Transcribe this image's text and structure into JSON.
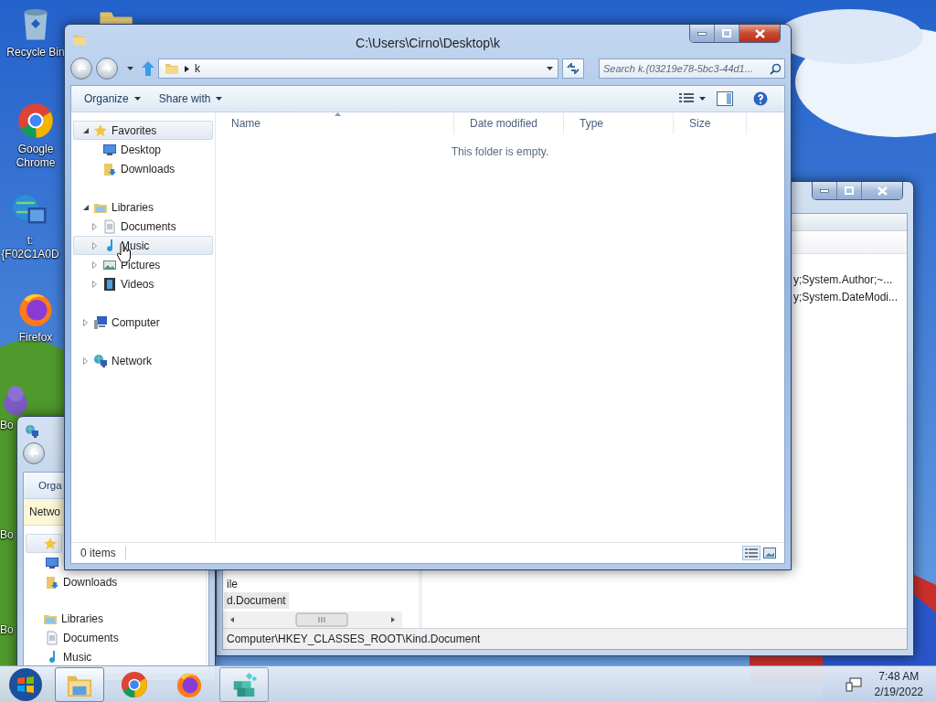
{
  "desktop_icons": [
    {
      "kind": "recycle",
      "label": "Recycle Bin"
    },
    {
      "kind": "folder"
    },
    {
      "kind": "chrome",
      "label": "Google Chrome"
    },
    {
      "kind": "globe_monitor",
      "label": "t:{F02C1A0D"
    },
    {
      "kind": "firefox",
      "label": "Firefox"
    },
    {
      "kind": "figure",
      "label": "Bo"
    },
    {
      "label": "Bo"
    },
    {
      "label": "Bo"
    }
  ],
  "registry_window": {
    "tree_items": [
      {
        "label": "ile",
        "selected": false
      },
      {
        "label": "d.Document",
        "selected": true
      }
    ],
    "values": [
      "y;System.Author;~...",
      "y;System.DateModi..."
    ],
    "status_bar": "Computer\\HKEY_CLASSES_ROOT\\Kind.Document"
  },
  "back_window": {
    "toolbar": "Orga",
    "info_bar": "Netwo",
    "nav": [
      {
        "kind": "favorites",
        "highlighted": true,
        "children": [
          {
            "kind": "desktop",
            "highlighted": false
          },
          {
            "kind": "downloads",
            "label": "Downloads",
            "highlighted": false
          }
        ]
      },
      {
        "kind": "libraries",
        "label": "Libraries",
        "highlighted": false,
        "children": [
          {
            "kind": "documents",
            "label": "Documents",
            "highlighted": false
          },
          {
            "kind": "music",
            "label": "Music",
            "highlighted": false
          }
        ]
      }
    ]
  },
  "window": {
    "title": "C:\\Users\\Cirno\\Desktop\\k",
    "breadcrumb": [
      "k"
    ],
    "search": {
      "placeholder": "Search k.{03219e78-5bc3-44d1..."
    },
    "toolbar": [
      "Organize",
      "Share with"
    ],
    "nav": [
      {
        "kind": "favorites",
        "label": "Favorites",
        "expanded": true,
        "highlighted": true,
        "children": [
          {
            "kind": "desktop",
            "label": "Desktop",
            "highlighted": false
          },
          {
            "kind": "downloads",
            "label": "Downloads",
            "highlighted": false
          }
        ]
      },
      {
        "kind": "libraries",
        "label": "Libraries",
        "expanded": true,
        "highlighted": false,
        "children": [
          {
            "kind": "documents",
            "label": "Documents",
            "expanded": false,
            "highlighted": false
          },
          {
            "kind": "music",
            "label": "Music",
            "expanded": false,
            "highlighted": true
          },
          {
            "kind": "pictures",
            "label": "Pictures",
            "expanded": false,
            "highlighted": false
          },
          {
            "kind": "videos",
            "label": "Videos",
            "expanded": false,
            "highlighted": false
          }
        ]
      },
      {
        "kind": "computer",
        "label": "Computer",
        "expanded": false,
        "highlighted": false
      },
      {
        "kind": "network",
        "label": "Network",
        "expanded": false,
        "highlighted": false
      }
    ],
    "columns": [
      {
        "label": "Name",
        "sorted": true
      },
      {
        "label": "Date modified",
        "sorted": false
      },
      {
        "label": "Type",
        "sorted": false
      },
      {
        "label": "Size",
        "sorted": false
      }
    ],
    "empty_message": "This folder is empty.",
    "status_bar": "0 items"
  },
  "taskbar": {
    "apps": [
      {
        "kind": "explorer",
        "running": true,
        "selected": true
      },
      {
        "kind": "chrome",
        "running": false,
        "selected": false
      },
      {
        "kind": "firefox",
        "running": false,
        "selected": false
      },
      {
        "kind": "registry",
        "running": true,
        "selected": false
      }
    ],
    "clock": {
      "time": "7:48 AM",
      "date": "2/19/2022"
    }
  }
}
